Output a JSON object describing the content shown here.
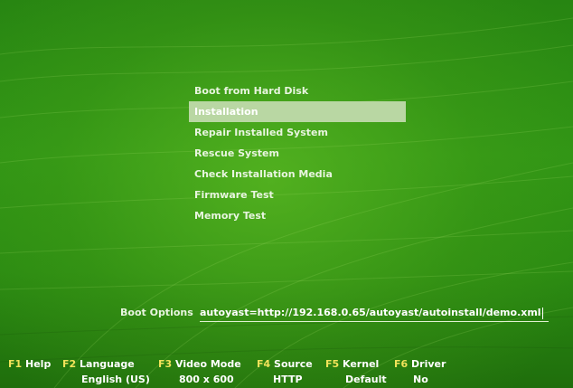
{
  "menu": {
    "items": [
      {
        "label": "Boot from Hard Disk",
        "selected": false
      },
      {
        "label": "Installation",
        "selected": true
      },
      {
        "label": "Repair Installed System",
        "selected": false
      },
      {
        "label": "Rescue System",
        "selected": false
      },
      {
        "label": "Check Installation Media",
        "selected": false
      },
      {
        "label": "Firmware Test",
        "selected": false
      },
      {
        "label": "Memory Test",
        "selected": false
      }
    ],
    "highlight_color": "#b9d7a3"
  },
  "boot_options": {
    "label": "Boot Options",
    "value": "autoyast=http://192.168.0.65/autoyast/autoinstall/demo.xml"
  },
  "function_keys": [
    {
      "key": "F1",
      "name": "Help",
      "value": ""
    },
    {
      "key": "F2",
      "name": "Language",
      "value": "English (US)"
    },
    {
      "key": "F3",
      "name": "Video Mode",
      "value": "800 x 600"
    },
    {
      "key": "F4",
      "name": "Source",
      "value": "HTTP"
    },
    {
      "key": "F5",
      "name": "Kernel",
      "value": "Default"
    },
    {
      "key": "F6",
      "name": "Driver",
      "value": "No"
    }
  ],
  "colors": {
    "background": "#2c8a12",
    "key_color": "#f2e35a",
    "text_color": "#ffffff"
  }
}
